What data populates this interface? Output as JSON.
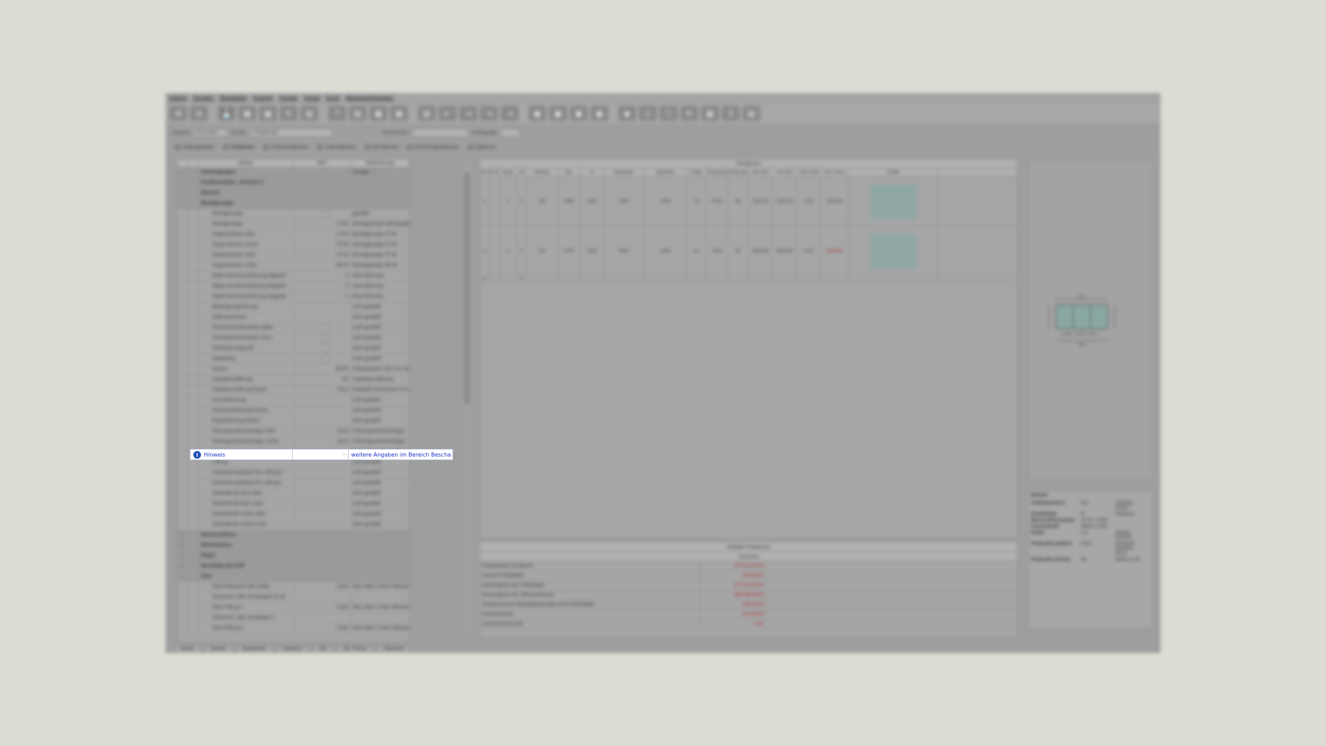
{
  "menu": [
    "Auftrag",
    "Drucken",
    "Bearbeiten",
    "Anzeige",
    "Fenster",
    "Extras",
    "Excel",
    "Warenkonfiguration"
  ],
  "filter": {
    "angebot_label": "Angebot",
    "angebot_value": "20.8.2021",
    "kunde_label": "Kunde",
    "kunde_value": "1  Testkunde",
    "kommission_label": "Kommission",
    "auftragsdat_label": "Auftragsdat"
  },
  "tabs": [
    "Auftragsdaten",
    "Positionen",
    "Preiskonditionen",
    "Lieferadresse",
    "Alt.Adresse",
    "Rechnungsadresse",
    "Optionen"
  ],
  "tree": {
    "headers": [
      "",
      "",
      "Attribut",
      "Wert",
      "Bezeichnung"
    ],
    "rows": [
      {
        "exp": "–",
        "level": "group",
        "label": "Vorbelegungen",
        "value": "",
        "desc": "Vorlage ---"
      },
      {
        "exp": "",
        "level": "group",
        "label": "Positionsdaten - Position 2",
        "value": "",
        "desc": ""
      },
      {
        "exp": "–",
        "level": "group",
        "label": "Element",
        "value": "",
        "desc": ""
      },
      {
        "exp": "",
        "level": "group",
        "label": "Montagezarge",
        "value": "",
        "desc": ""
      },
      {
        "exp": "",
        "level": "l3",
        "label": "Montagezarge",
        "value": "",
        "desc": "gewählt",
        "check": true
      },
      {
        "exp": "",
        "level": "l3",
        "label": "Montagezarge",
        "value": "Z-HR",
        "desc": "Montagezarge wärmegedämmt für"
      },
      {
        "exp": "",
        "level": "l3",
        "label": "Zargenrahmen links",
        "value": "ZT-W",
        "desc": "Montagezarge ZT-W"
      },
      {
        "exp": "",
        "level": "l3",
        "label": "Zargenrahmen rechts",
        "value": "ZT-W",
        "desc": "Montagezarge ZT-W"
      },
      {
        "exp": "",
        "level": "l3",
        "label": "Zargenrahmen oben",
        "value": "ZT-W",
        "desc": "Montagezarge ZT-W"
      },
      {
        "exp": "",
        "level": "l3",
        "label": "Zargenrahmen unten",
        "value": "ZB-W",
        "desc": "Montagezarge ZB-W"
      },
      {
        "exp": "",
        "level": "l3",
        "label": "Rabet-Anschlussbohrung Magnetk",
        "value": "0",
        "desc": "ohne Bohrung"
      },
      {
        "exp": "",
        "level": "l3",
        "label": "Rabet-Anschlussbohrung Magnetk",
        "value": "0",
        "desc": "ohne Bohrung"
      },
      {
        "exp": "",
        "level": "l3",
        "label": "Rabet-Anschlussbohrung Magnetk",
        "value": "0",
        "desc": "ohne Bohrung"
      },
      {
        "exp": "",
        "level": "l3",
        "label": "Befestigungsbohrung",
        "value": "",
        "desc": "nicht gewählt"
      },
      {
        "exp": "",
        "level": "l3",
        "label": "Fallenanschluss",
        "value": "",
        "desc": "nicht gewählt"
      },
      {
        "exp": "",
        "level": "l3",
        "label": "Fensteranschlussfolie außen",
        "value": "",
        "desc": "nicht gewählt",
        "check": true
      },
      {
        "exp": "",
        "level": "l3",
        "label": "Fensteranschlussfolie innen",
        "value": "",
        "desc": "nicht gewählt",
        "check": true
      },
      {
        "exp": "",
        "level": "l3",
        "label": "Verbreiterungsprofil",
        "value": "",
        "desc": "nicht gewählt",
        "check": true
      },
      {
        "exp": "",
        "level": "l3",
        "label": "Koppelung",
        "value": "",
        "desc": "nicht gewählt",
        "check": true
      },
      {
        "exp": "",
        "level": "l3",
        "label": "Kanten",
        "value": "40200",
        "desc": "Aufsatzkanten 200 mm ohne Innenl"
      },
      {
        "exp": "",
        "level": "l3",
        "label": "Inspektionsöffnung",
        "value": "I10",
        "desc": "Inspektionsöffnung"
      },
      {
        "exp": "",
        "level": "l3",
        "label": "Inspektionsöffnung Farbe",
        "value": "P113",
        "desc": "Perlweiß Feinstruktur P113 (Bei. 10"
      },
      {
        "exp": "",
        "level": "l3",
        "label": "Innendämmung",
        "value": "",
        "desc": "nicht gewählt"
      },
      {
        "exp": "",
        "level": "l3",
        "label": "Sonderausführung Kanten",
        "value": "",
        "desc": "nicht gewählt"
      },
      {
        "exp": "",
        "level": "l3",
        "label": "Entausführung Kanten",
        "value": "",
        "desc": "nicht gewählt"
      },
      {
        "exp": "",
        "level": "l3",
        "label": "Führungsschienenträger links",
        "value": "ZA15",
        "desc": "Führungsschienenträger"
      },
      {
        "exp": "",
        "level": "l3",
        "label": "Führungsschienenträger rechts",
        "value": "ZA15",
        "desc": "Führungsschienenträger"
      },
      {
        "exp": "",
        "level": "l3",
        "label": "Hinweis",
        "value": "",
        "desc": "weitere Angaben im Bereich Bescha"
      },
      {
        "exp": "",
        "level": "l3",
        "label": "Lüftung",
        "value": "",
        "desc": "nicht gewählt"
      },
      {
        "exp": "",
        "level": "l3",
        "label": "Verbreiterungsblock für Lüftung li",
        "value": "",
        "desc": "nicht gewählt"
      },
      {
        "exp": "",
        "level": "l3",
        "label": "Verbreiterungsblock für Lüftung r",
        "value": "",
        "desc": "nicht gewählt"
      },
      {
        "exp": "",
        "level": "l3",
        "label": "Dekorblende links oben",
        "value": "",
        "desc": "nicht gewählt"
      },
      {
        "exp": "",
        "level": "l3",
        "label": "Dekorblende links unten",
        "value": "",
        "desc": "nicht gewählt"
      },
      {
        "exp": "",
        "level": "l3",
        "label": "Dekorblende rechts oben",
        "value": "",
        "desc": "nicht gewählt"
      },
      {
        "exp": "",
        "level": "l3",
        "label": "Dekorblende rechts unten",
        "value": "",
        "desc": "nicht gewählt"
      },
      {
        "exp": "+",
        "level": "group",
        "label": "Bauanschlüsse",
        "value": "",
        "desc": ""
      },
      {
        "exp": "+",
        "level": "group",
        "label": "Blendrahmen",
        "value": "",
        "desc": ""
      },
      {
        "exp": "+",
        "level": "group",
        "label": "Flügel",
        "value": "",
        "desc": ""
      },
      {
        "exp": "+",
        "level": "group",
        "label": "Beschlag und Griff",
        "value": "",
        "desc": ""
      },
      {
        "exp": "–",
        "level": "group",
        "label": "Glas",
        "value": "",
        "desc": ""
      },
      {
        "exp": "",
        "level": "l3",
        "label": "Glas-Füllung für alle Felder",
        "value": "124/5",
        "desc": "Max-Vakor 3-fach Wäreprodukt und W"
      },
      {
        "exp": "",
        "level": "l3",
        "label": "Ornament- oder Sonderglas für all",
        "value": "",
        "desc": ""
      },
      {
        "exp": "",
        "level": "l3",
        "label": "Glas-Füllung 1",
        "value": "124/5",
        "desc": "Max-Vakor 3-fach Wäreprodukt und W"
      },
      {
        "exp": "",
        "level": "l3",
        "label": "Ornament- oder Sonderglas 1",
        "value": "",
        "desc": ""
      },
      {
        "exp": "",
        "level": "l3",
        "label": "Glas-Füllung 2",
        "value": "124/5",
        "desc": "Max-Vakor 3-fach Wäreprodukt und W"
      }
    ]
  },
  "hinweis": {
    "label": "Hinweis",
    "text": "weitere Angaben im Bereich Bescha"
  },
  "positions": {
    "title": "Positionen",
    "headers": [
      "Pos",
      "K-Pos",
      "Stück",
      "Art",
      "Artikelnr.",
      "B/L",
      "H",
      "Baubreite",
      "Bauhöhe",
      "Felder",
      "Farbcode",
      "Farbcode2",
      "EK-N/St",
      "VK-N/St",
      "VKS-N/St",
      "Pos.-Preis",
      "Grafik"
    ],
    "rows": [
      {
        "pos": "1",
        "kpos": "",
        "stk": "1",
        "art": "0",
        "artnr": "204",
        "bl": "2600",
        "h": "2100",
        "bb": "2600",
        "bh": "2100",
        "felder": "2-1",
        "fc": "P113",
        "fc2": "45",
        "ek": "2225.23",
        "vk": "2225.23",
        "vks": "0.00",
        "preis": "2225.23",
        "red": false
      },
      {
        "pos": "2",
        "kpos": "",
        "stk": "1",
        "art": "0",
        "artnr": "911",
        "bl": "4770",
        "h": "2100",
        "bb": "4800",
        "bh": "2200",
        "felder": "3-1",
        "fc": "P113",
        "fc2": "45",
        "ek": "3040.66",
        "vk": "3040.66",
        "vks": "0.00",
        "preis": "3040.66",
        "red": true
      }
    ],
    "blank_row": {
      "pos": "3",
      "art": "0"
    },
    "global_bar": "Globale Positionen",
    "sum_bar": "Summen"
  },
  "sums": [
    {
      "k": "Gesamtpreis Positionen",
      "v": "5773,01 EUR"
    },
    {
      "k": "Summe Fußrabatte",
      "v": "0,00 EUR"
    },
    {
      "k": "Gesamtpreis inkl. Fußrabatte",
      "v": "5773,01 EUR"
    },
    {
      "k": "Gesamtpreis inkl. Mehrwertsteuer",
      "v": "6870,88 EUR"
    },
    {
      "k": "Gesamtsumme Montageleistungen ohne Fußrabatte",
      "v": "0,00 EUR"
    },
    {
      "k": "Gewicht Brutto",
      "v": "0,00 EUR"
    },
    {
      "k": "Gewicht Brutto (St)",
      "v": "0.00"
    }
  ],
  "properties": {
    "title": "Einheit",
    "rows": [
      {
        "k": "Artikelnummer",
        "v": "911",
        "x": "Schiebe-rechts"
      },
      {
        "k": "Produkttyp",
        "v": "B",
        "x": "Hebesch"
      },
      {
        "k": "Blend-dimensional",
        "v": "4770 x 2180",
        "x": ""
      },
      {
        "k": "Gesamtmaß",
        "v": "4800 x 2200",
        "x": ""
      },
      {
        "k": "Farbe",
        "v": "2-1",
        "x": "Alumin. Kombin."
      },
      {
        "k": "Farbcode (außen)",
        "v": "P113",
        "x": "Perlweiß Feinstru P113"
      },
      {
        "k": "Farbcode (innen)",
        "v": "45",
        "x": "Weiß av 45"
      }
    ]
  },
  "preview": {
    "dim_top": "4770",
    "dim_bottom": "4800",
    "dim_left": "2100",
    "dim_right": "2200",
    "split": "1-1590 | 1-1590 | 1590-1"
  },
  "bottom_tabs": [
    "Neuer",
    "Ändern",
    "Bearbeiten",
    "Kopieren",
    "Info",
    "Akt. Preise",
    "Übersetzt"
  ],
  "colors": {
    "accent_blue": "#1a2fd0",
    "highlight_bg": "#ffffff",
    "price_red": "#b02020",
    "glass": "#8fa7a5"
  }
}
